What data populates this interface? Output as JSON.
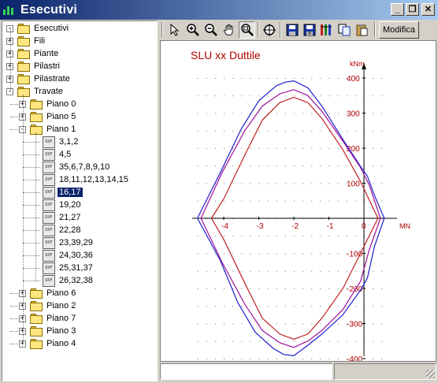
{
  "window": {
    "title": "Esecutivi",
    "buttons": {
      "minimize": "_",
      "maximize": "❐",
      "close": "✕"
    }
  },
  "tree": {
    "root": "Esecutivi",
    "folders": [
      "Fili",
      "Piante",
      "Pilastri",
      "Pilastrate",
      "Travate"
    ],
    "travate_children": [
      "Piano 0",
      "Piano 5",
      "Piano 1"
    ],
    "piano1_items": [
      "3,1,2",
      "4,5",
      "35,6,7,8,9,10",
      "18,11,12,13,14,15",
      "16,17",
      "19,20",
      "21,27",
      "22,28",
      "23,39,29",
      "24,30,36",
      "25,31,37",
      "26,32,38"
    ],
    "after_items": [
      "Piano 6",
      "Piano 2",
      "Piano 7",
      "Piano 3",
      "Piano 4"
    ],
    "selected": "16,17",
    "file_icon_text": "DXF"
  },
  "toolbar": {
    "tools": [
      "pointer-icon",
      "zoom-in-icon",
      "zoom-out-icon",
      "pan-hand-icon",
      "zoom-fit-icon",
      "zoom-window-icon",
      "save-icon",
      "save-as-icon",
      "tools-icon",
      "copy-icon",
      "paste-icon"
    ],
    "modifica_label": "Modifica"
  },
  "chart": {
    "title": "SLU xx Duttile",
    "y_unit": "kNm",
    "x_unit": "MN"
  },
  "chart_data": {
    "type": "line",
    "title": "SLU xx Duttile",
    "xlabel": "MN",
    "ylabel": "kNm",
    "xlim": [
      -4.8,
      0.65
    ],
    "ylim": [
      -420,
      420
    ],
    "x_ticks": [
      -4,
      -3,
      -2,
      -1,
      0
    ],
    "y_ticks": [
      400,
      300,
      200,
      100,
      -100,
      -200,
      -300,
      -400
    ],
    "x_tick_labels": [
      "-4",
      "-3",
      "-2",
      "-1",
      "0"
    ],
    "y_tick_labels": [
      "400",
      "300",
      "200",
      "100",
      "-100",
      "-200",
      "-300",
      "-400"
    ],
    "grid": "dotted",
    "series": [
      {
        "color": "#1f1fcc",
        "x": [
          -4.75,
          -4.1,
          -3.5,
          -3.0,
          -2.5,
          -2.25,
          -2.0,
          -1.6,
          -1.2,
          -0.6,
          -0.1,
          0.1,
          0.3,
          0.58,
          0.3,
          0.1,
          -0.1,
          -0.6,
          -1.2,
          -1.6,
          -2.0,
          -2.3,
          -2.6,
          -3.1,
          -3.6,
          -4.1,
          -4.75
        ],
        "y": [
          0,
          130,
          255,
          335,
          378,
          388,
          392,
          372,
          320,
          225,
          148,
          120,
          65,
          0,
          -80,
          -170,
          -205,
          -275,
          -330,
          -362,
          -392,
          -388,
          -370,
          -325,
          -240,
          -120,
          0
        ]
      },
      {
        "color": "#a0109a",
        "x": [
          -4.65,
          -4.05,
          -3.4,
          -2.9,
          -2.4,
          -2.0,
          -1.6,
          -1.2,
          -0.6,
          -0.1,
          0.15,
          0.47,
          0.15,
          -0.1,
          -0.6,
          -1.2,
          -1.6,
          -2.0,
          -2.4,
          -2.9,
          -3.4,
          -4.05,
          -4.65
        ],
        "y": [
          0,
          130,
          250,
          320,
          355,
          367,
          350,
          305,
          220,
          145,
          95,
          0,
          -90,
          -180,
          -260,
          -320,
          -350,
          -368,
          -355,
          -320,
          -245,
          -125,
          0
        ]
      },
      {
        "color": "#c02020",
        "x": [
          -4.35,
          -4.0,
          -3.4,
          -2.9,
          -2.4,
          -2.0,
          -1.6,
          -1.2,
          -0.6,
          -0.1,
          0.4,
          -0.1,
          -0.6,
          -1.2,
          -1.6,
          -2.0,
          -2.4,
          -2.9,
          -3.4,
          -4.0,
          -4.35
        ],
        "y": [
          0,
          55,
          180,
          280,
          330,
          345,
          330,
          285,
          195,
          105,
          0,
          -100,
          -200,
          -285,
          -330,
          -345,
          -330,
          -285,
          -185,
          -60,
          0
        ]
      }
    ]
  }
}
